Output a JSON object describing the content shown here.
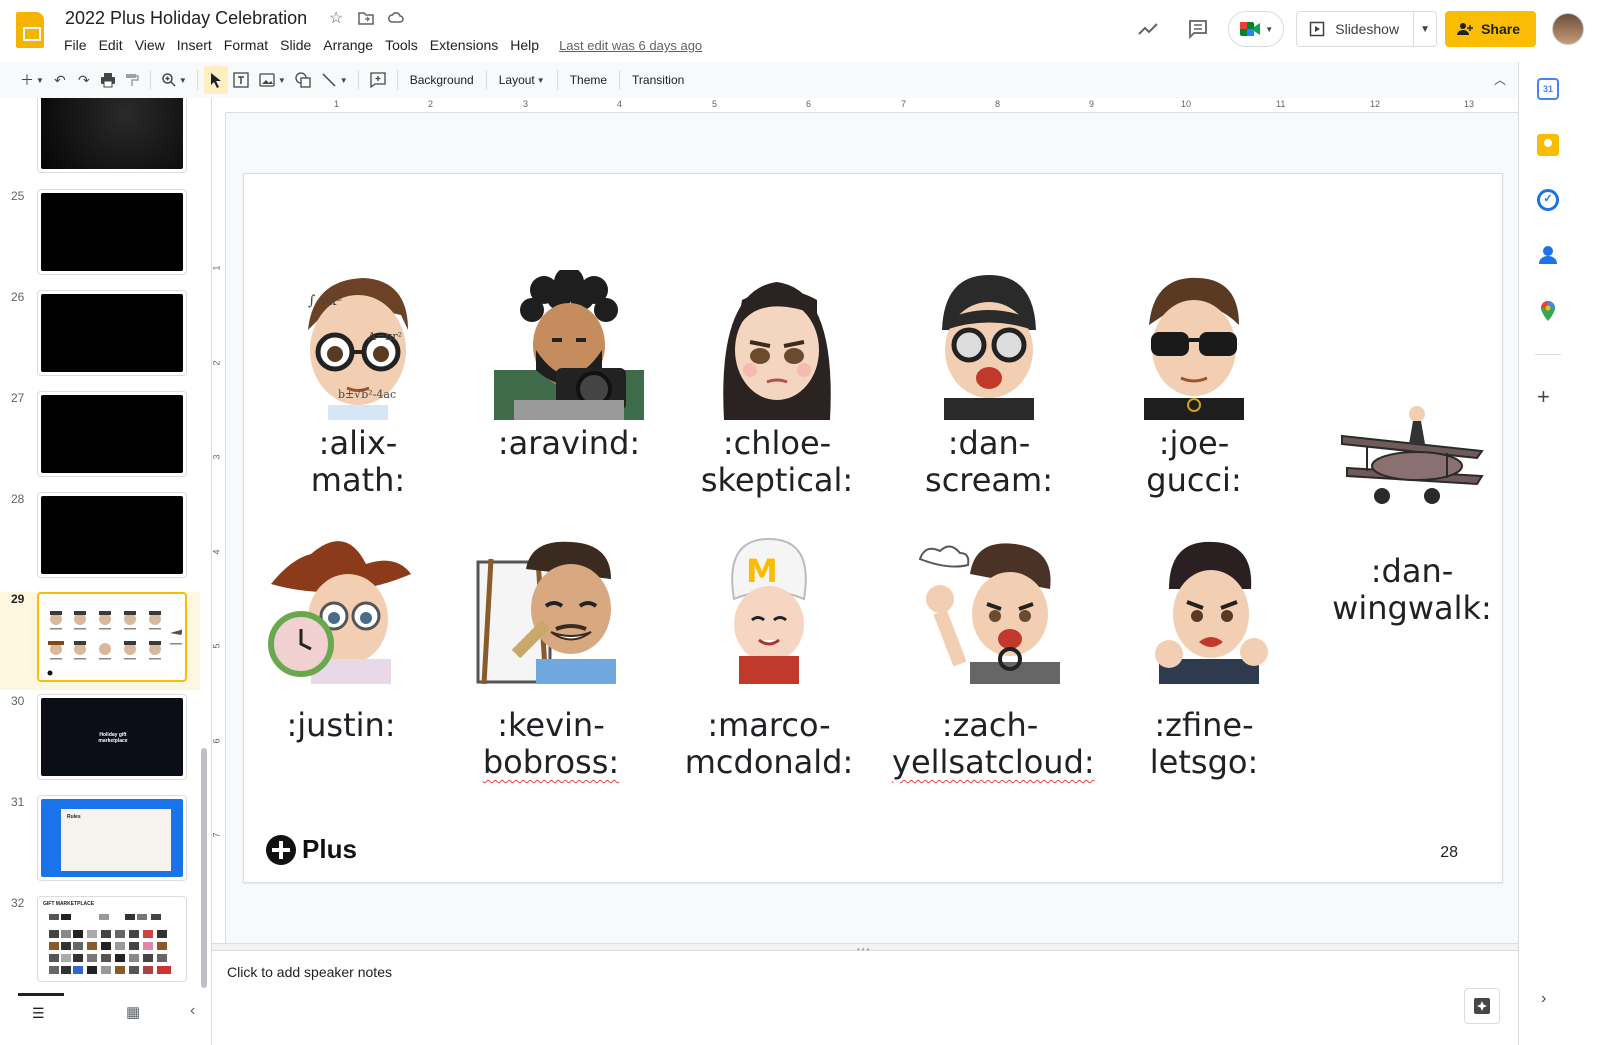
{
  "header": {
    "title": "2022 Plus Holiday Celebration",
    "menus": [
      "File",
      "Edit",
      "View",
      "Insert",
      "Format",
      "Slide",
      "Arrange",
      "Tools",
      "Extensions",
      "Help"
    ],
    "last_edit": "Last edit was 6 days ago",
    "slideshow_label": "Slideshow",
    "share_label": "Share"
  },
  "toolbar": {
    "background": "Background",
    "layout": "Layout",
    "theme": "Theme",
    "transition": "Transition"
  },
  "ruler": {
    "h": [
      "1",
      "2",
      "3",
      "4",
      "5",
      "6",
      "7",
      "8",
      "9",
      "10",
      "11",
      "12",
      "13"
    ],
    "v": [
      "1",
      "2",
      "3",
      "4",
      "5",
      "6",
      "7"
    ]
  },
  "filmstrip": {
    "slides": [
      {
        "num": "25"
      },
      {
        "num": "26"
      },
      {
        "num": "27"
      },
      {
        "num": "28"
      },
      {
        "num": "29"
      },
      {
        "num": "30",
        "text": "Holiday gift marketplace"
      },
      {
        "num": "31",
        "text": "Rules"
      },
      {
        "num": "32",
        "text": "GIFT MARKETPLACE"
      }
    ]
  },
  "slide": {
    "emojis": [
      {
        "l1": ":alix-math:",
        "l2": ""
      },
      {
        "l1": ":aravind:",
        "l2": ""
      },
      {
        "l1": ":chloe-",
        "l2": "skeptical:"
      },
      {
        "l1": ":dan-",
        "l2": "scream:"
      },
      {
        "l1": ":joe-gucci:",
        "l2": ""
      },
      {
        "l1": ":dan-",
        "l2": "wingwalk:"
      },
      {
        "l1": ":justin:",
        "l2": ""
      },
      {
        "l1": ":kevin-",
        "l2": "bobross:"
      },
      {
        "l1": ":marco-",
        "l2": "mcdonald:"
      },
      {
        "l1": ":zach-",
        "l2": "yellsatcloud:"
      },
      {
        "l1": ":zfine-",
        "l2": "letsgo:"
      }
    ],
    "logo_text": "Plus",
    "page_number": "28"
  },
  "notes": {
    "placeholder": "Click to add speaker notes"
  },
  "colors": {
    "accent": "#fbbc04",
    "slides_yellow": "#f4b400"
  }
}
